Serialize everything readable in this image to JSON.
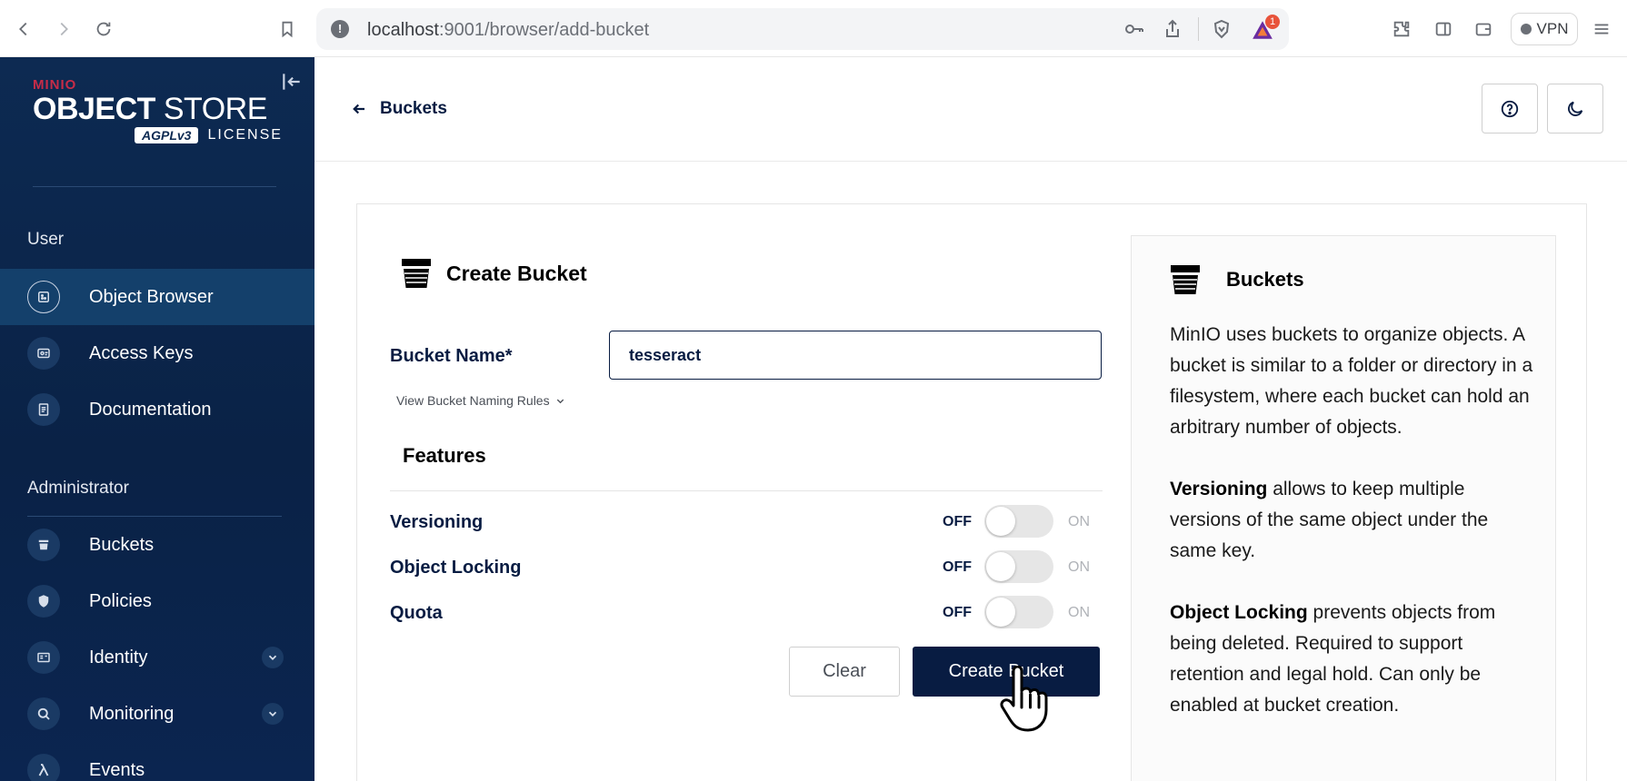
{
  "browser": {
    "url_host": "localhost",
    "url_rest": ":9001/browser/add-bucket",
    "vpn_label": "VPN",
    "badge_count": "1"
  },
  "sidebar": {
    "brand_minio": "MINIO",
    "brand_object": "OBJECT",
    "brand_store": "STORE",
    "brand_agpl": "AGPLv3",
    "brand_license": "LICENSE",
    "section_user": "User",
    "section_admin": "Administrator",
    "items": [
      {
        "label": "Object Browser",
        "icon": "object-browser-icon",
        "active": true
      },
      {
        "label": "Access Keys",
        "icon": "access-keys-icon",
        "active": false
      },
      {
        "label": "Documentation",
        "icon": "documentation-icon",
        "active": false
      },
      {
        "label": "Buckets",
        "icon": "buckets-icon",
        "active": false
      },
      {
        "label": "Policies",
        "icon": "policies-icon",
        "active": false
      },
      {
        "label": "Identity",
        "icon": "identity-icon",
        "active": false,
        "expandable": true
      },
      {
        "label": "Monitoring",
        "icon": "monitoring-icon",
        "active": false,
        "expandable": true
      },
      {
        "label": "Events",
        "icon": "lambda-icon",
        "active": false
      }
    ]
  },
  "header": {
    "back_label": "Buckets",
    "help_icon": "help-icon",
    "theme_icon": "moon-icon"
  },
  "form": {
    "title": "Create Bucket",
    "bucket_name_label": "Bucket Name*",
    "bucket_name_value": "tesseract",
    "naming_rules": "View Bucket Naming Rules",
    "features_title": "Features",
    "features": [
      {
        "label": "Versioning",
        "off": "OFF",
        "on": "ON",
        "enabled": false
      },
      {
        "label": "Object Locking",
        "off": "OFF",
        "on": "ON",
        "enabled": false
      },
      {
        "label": "Quota",
        "off": "OFF",
        "on": "ON",
        "enabled": false
      }
    ],
    "clear_label": "Clear",
    "create_label": "Create Bucket"
  },
  "help": {
    "title": "Buckets",
    "p1": "MinIO uses buckets to organize objects. A bucket is similar to a folder or directory in a filesystem, where each bucket can hold an arbitrary number of objects.",
    "p2_bold": "Versioning",
    "p2_rest": " allows to keep multiple versions of the same object under the same key.",
    "p3_bold": "Object Locking",
    "p3_rest": " prevents objects from being deleted. Required to support retention and legal hold. Can only be enabled at bucket creation."
  },
  "colors": {
    "sidebar_bg": "#0b2550",
    "primary": "#081c42",
    "brand_red": "#c72c48"
  }
}
